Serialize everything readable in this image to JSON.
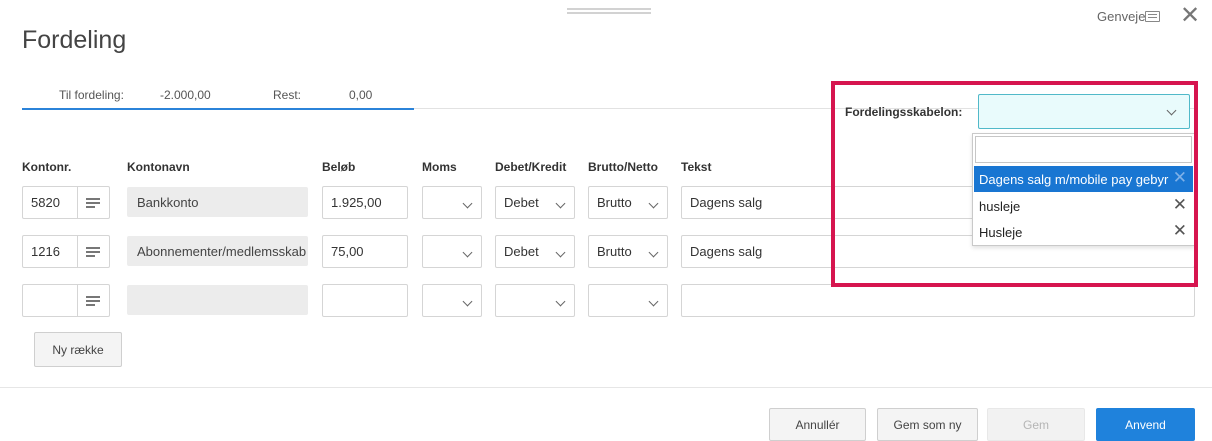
{
  "dialog": {
    "title": "Fordeling",
    "shortcuts_label": "Genveje"
  },
  "summary": {
    "to_distribute_label": "Til fordeling:",
    "to_distribute_value": "-2.000,00",
    "rest_label": "Rest:",
    "rest_value": "0,00"
  },
  "columns": {
    "account_no": "Kontonr.",
    "account_name": "Kontonavn",
    "amount": "Beløb",
    "vat": "Moms",
    "debit_credit": "Debet/Kredit",
    "gross_net": "Brutto/Netto",
    "text": "Tekst"
  },
  "rows": [
    {
      "account_no": "5820",
      "account_name": "Bankkonto",
      "amount": "1.925,00",
      "vat": "",
      "debit_credit": "Debet",
      "gross_net": "Brutto",
      "text": "Dagens salg"
    },
    {
      "account_no": "1216",
      "account_name": "Abonnementer/medlemsskab",
      "amount": "75,00",
      "vat": "",
      "debit_credit": "Debet",
      "gross_net": "Brutto",
      "text": "Dagens salg"
    },
    {
      "account_no": "",
      "account_name": "",
      "amount": "",
      "vat": "",
      "debit_credit": "",
      "gross_net": "",
      "text": ""
    }
  ],
  "add_row_label": "Ny række",
  "template": {
    "label": "Fordelingsskabelon:",
    "value": "",
    "search_value": "",
    "options": [
      {
        "label": "Dagens salg m/mobile pay gebyr",
        "selected": true
      },
      {
        "label": "husleje",
        "selected": false
      },
      {
        "label": "Husleje",
        "selected": false
      }
    ]
  },
  "footer": {
    "cancel_label": "Annullér",
    "save_as_new_label": "Gem som ny",
    "save_label": "Gem",
    "apply_label": "Anvend"
  },
  "colors": {
    "accent": "#1f82dc",
    "highlight_border": "#d6154f",
    "template_select_bg": "#e9fbfc"
  }
}
